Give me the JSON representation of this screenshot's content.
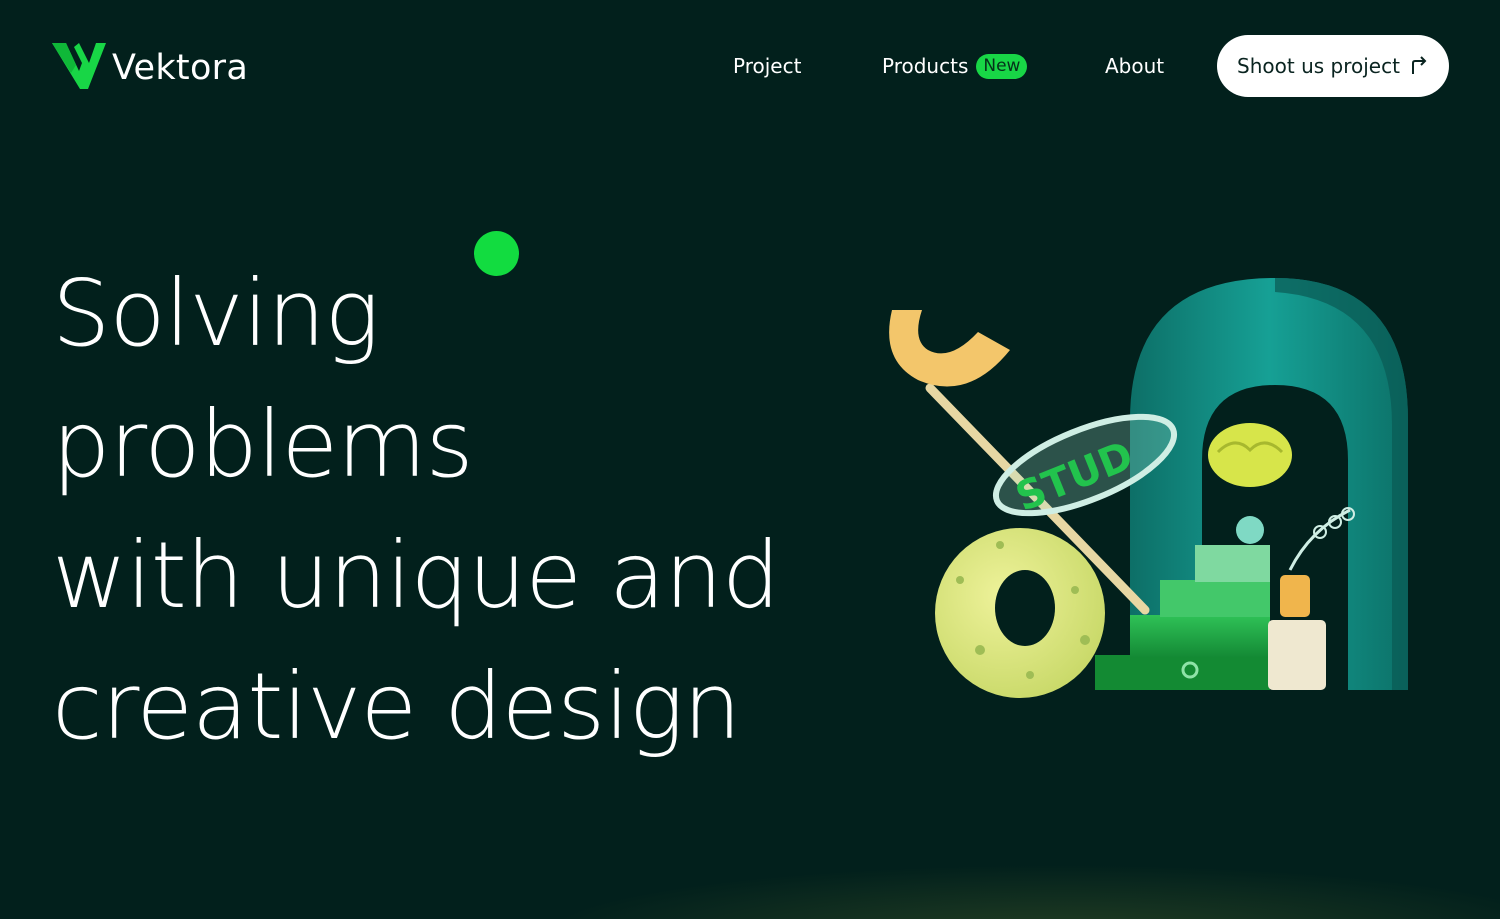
{
  "brand": {
    "name": "Vektora",
    "logo_icon": "v-logo-icon",
    "accent_color": "#18d646",
    "background_color": "#02201c"
  },
  "nav": {
    "items": [
      {
        "label": "Project"
      },
      {
        "label": "Products",
        "badge": "New"
      },
      {
        "label": "About"
      }
    ],
    "cta": {
      "label": "Shoot us project",
      "icon": "arrow-up-right-icon"
    }
  },
  "hero": {
    "lines": [
      "Solving",
      "problems",
      "with unique and",
      "creative design"
    ],
    "ring_text": "STUD"
  }
}
